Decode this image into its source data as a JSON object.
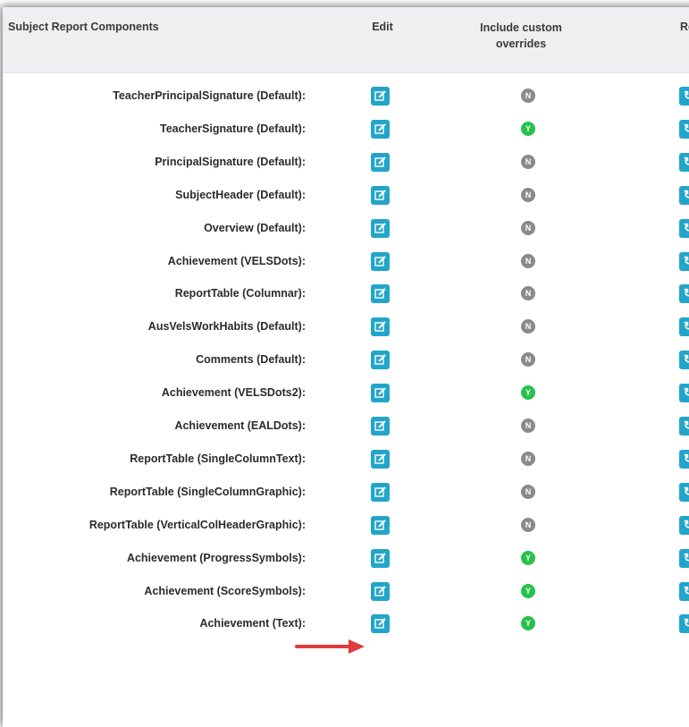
{
  "header": {
    "components": "Subject Report Components",
    "edit": "Edit",
    "include_line1": "Include custom",
    "include_line2": "overrides",
    "reset": "Reset"
  },
  "colors": {
    "edit_button": "#23a5c9",
    "badge_no": "#8a8a8a",
    "badge_yes": "#26c24a",
    "arrow": "#e03a3a"
  },
  "icons": {
    "edit": "edit-icon",
    "reset": "refresh-icon",
    "arrow": "red-arrow-annotation"
  },
  "rows": [
    {
      "label": "TeacherPrincipalSignature (Default):",
      "override": "N"
    },
    {
      "label": "TeacherSignature (Default):",
      "override": "Y"
    },
    {
      "label": "PrincipalSignature (Default):",
      "override": "N"
    },
    {
      "label": "SubjectHeader (Default):",
      "override": "N"
    },
    {
      "label": "Overview (Default):",
      "override": "N"
    },
    {
      "label": "Achievement (VELSDots):",
      "override": "N"
    },
    {
      "label": "ReportTable (Columnar):",
      "override": "N"
    },
    {
      "label": "AusVelsWorkHabits (Default):",
      "override": "N"
    },
    {
      "label": "Comments (Default):",
      "override": "N"
    },
    {
      "label": "Achievement (VELSDots2):",
      "override": "Y"
    },
    {
      "label": "Achievement (EALDots):",
      "override": "N"
    },
    {
      "label": "ReportTable (SingleColumnText):",
      "override": "N"
    },
    {
      "label": "ReportTable (SingleColumnGraphic):",
      "override": "N"
    },
    {
      "label": "ReportTable (VerticalColHeaderGraphic):",
      "override": "N"
    },
    {
      "label": "Achievement (ProgressSymbols):",
      "override": "Y"
    },
    {
      "label": "Achievement (ScoreSymbols):",
      "override": "Y"
    },
    {
      "label": "Achievement (Text):",
      "override": "Y"
    }
  ]
}
